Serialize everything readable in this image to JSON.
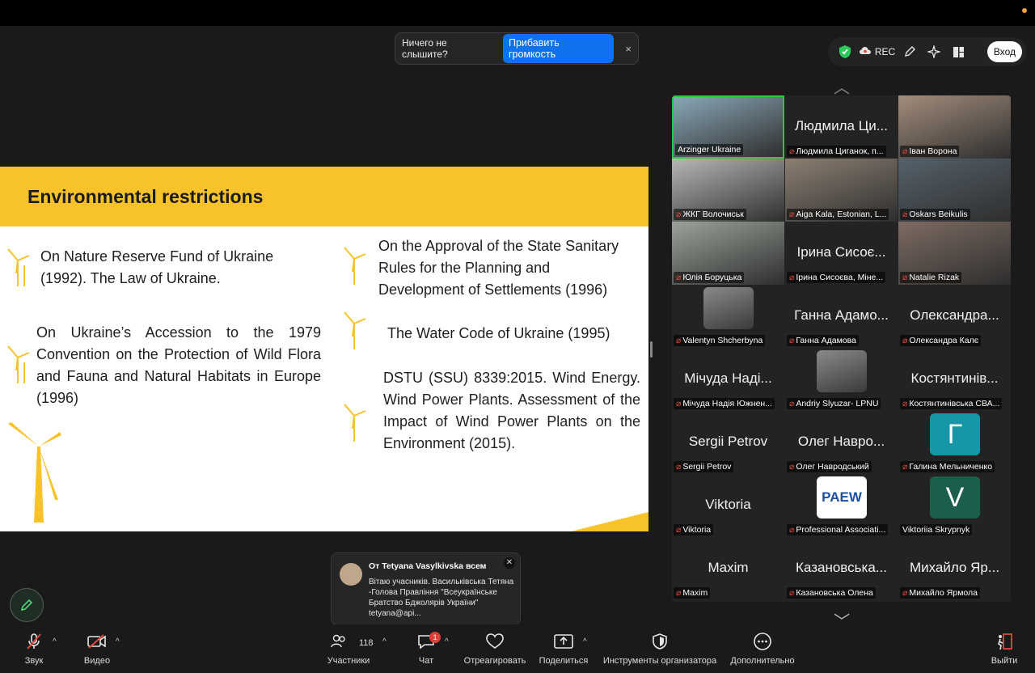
{
  "banner": {
    "text": "Ничего не слышите?",
    "button": "Прибавить громкость",
    "close": "×"
  },
  "top_controls": {
    "rec": "REC",
    "login": "Вход"
  },
  "slide": {
    "title": "Environmental restrictions",
    "items": [
      "On Nature Reserve Fund of Ukraine (1992). The Law of Ukraine.",
      "On Ukraine’s Accession to the 1979 Convention on the Protection of Wild Flora and Fauna and Natural Habitats in Europe (1996)",
      "On the Approval of the State Sanitary Rules for the Planning and Development of Settlements (1996)",
      "The Water Code of Ukraine (1995)",
      "DSTU (SSU) 8339:2015. Wind Energy. Wind Power Plants. Assessment of the Impact of Wind Power Plants on the Environment (2015)."
    ],
    "accent": "#f8c22a"
  },
  "participants": [
    {
      "big": "",
      "label": "Arzinger Ukraine",
      "muted": false,
      "video": true
    },
    {
      "big": "Людмила Ци...",
      "label": "Людмила Циганок, п...",
      "muted": true
    },
    {
      "big": "",
      "label": "Іван Ворона",
      "muted": true,
      "video": true
    },
    {
      "big": "",
      "label": "ЖКГ Волочиськ",
      "muted": true,
      "video": true
    },
    {
      "big": "",
      "label": "Aiga Kala, Estonian, L...",
      "muted": true,
      "video": true
    },
    {
      "big": "",
      "label": "Oskars Beikulis",
      "muted": true,
      "video": true
    },
    {
      "big": "",
      "label": "Юлія Боруцька",
      "muted": true,
      "video": true
    },
    {
      "big": "Ірина Сисоє...",
      "label": "Ірина Сисоєва, Міне...",
      "muted": true
    },
    {
      "big": "",
      "label": "Natalie Rizak",
      "muted": true,
      "video": true
    },
    {
      "big": "",
      "label": "Valentyn Shcherbyna",
      "muted": true,
      "avatar": "photo"
    },
    {
      "big": "Ганна Адамо...",
      "label": "Ганна Адамова",
      "muted": true
    },
    {
      "big": "Олександра...",
      "label": "Олександра Калє",
      "muted": true
    },
    {
      "big": "Мічуда Наді...",
      "label": "Мічуда Надія Южнен...",
      "muted": true
    },
    {
      "big": "",
      "label": "Andriy Slyuzar- LPNU",
      "muted": true,
      "avatar": "photo"
    },
    {
      "big": "Костянтинів...",
      "label": "Костянтинівська СВА...",
      "muted": true
    },
    {
      "big": "Sergii Petrov",
      "label": "Sergii Petrov",
      "muted": true
    },
    {
      "big": "Олег Навро...",
      "label": "Олег Навродський",
      "muted": true
    },
    {
      "big": "",
      "label": "Галина Мельниченко",
      "muted": true,
      "avatar": "letter",
      "letter": "Г",
      "color": "#1597a8"
    },
    {
      "big": "Viktoria",
      "label": "Viktoria",
      "muted": true
    },
    {
      "big": "",
      "label": "Professional Associati...",
      "muted": true,
      "avatar": "logo",
      "letter": "PAEW"
    },
    {
      "big": "",
      "label": "Viktoriia Skrypnyk",
      "muted": false,
      "avatar": "letter",
      "letter": "V",
      "color": "#1b5e4c"
    },
    {
      "big": "Maxim",
      "label": "Maxim",
      "muted": true
    },
    {
      "big": "Казановська...",
      "label": "Казановська Олена",
      "muted": true
    },
    {
      "big": "Михайло Яр...",
      "label": "Михайло Ярмола",
      "muted": true
    }
  ],
  "chat_popup": {
    "from": "От Tetyana Vasylkivska всем",
    "message": "Вітаю учасників. Васильківська Тетяна -Голова Правління \"Всеукраїнське Братство Бджолярів України\" tetyana@api..."
  },
  "toolbar": {
    "sound": "Звук",
    "video": "Видео",
    "participants": "Участники",
    "participants_count": "118",
    "chat": "Чат",
    "chat_badge": "1",
    "react": "Отреагировать",
    "share": "Поделиться",
    "host_tools": "Инструменты организатора",
    "more": "Дополнительно",
    "leave": "Выйти"
  }
}
